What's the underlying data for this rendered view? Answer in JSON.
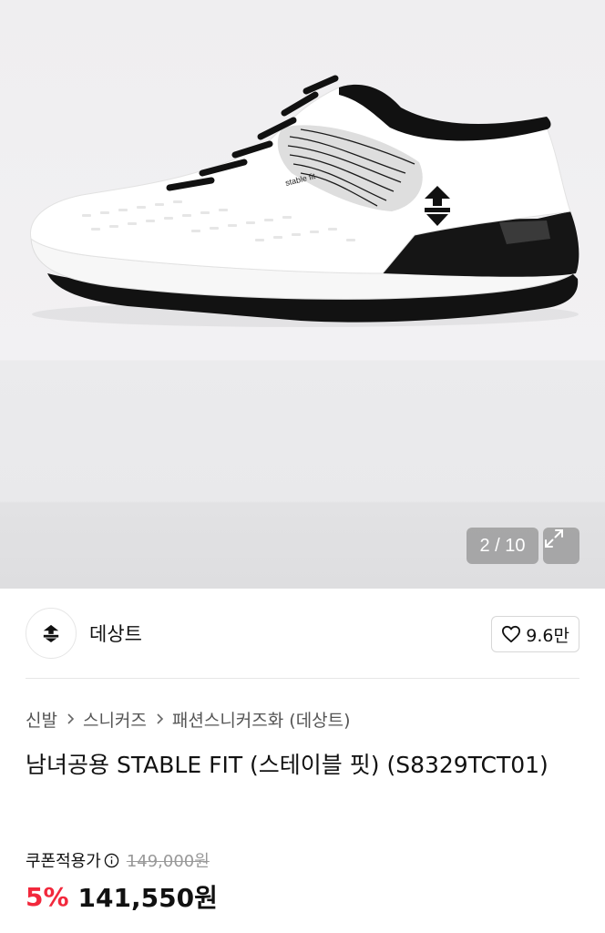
{
  "gallery": {
    "counter_current": "2",
    "counter_sep": " / ",
    "counter_total": "10",
    "shoe_tongue_text": "stable fit"
  },
  "brand": {
    "name": "데상트",
    "likes": "9.6만"
  },
  "breadcrumb": [
    "신발",
    "스니커즈",
    "패션스니커즈화 (데상트)"
  ],
  "product": {
    "title": "남녀공용 STABLE FIT (스테이블 핏) (S8329TCT01)"
  },
  "price": {
    "coupon_label": "쿠폰적용가",
    "original": "149,000원",
    "discount": "5%",
    "final": "141,550원"
  },
  "colors": {
    "discount": "#f2283c",
    "text": "#111111",
    "muted": "#999999"
  }
}
